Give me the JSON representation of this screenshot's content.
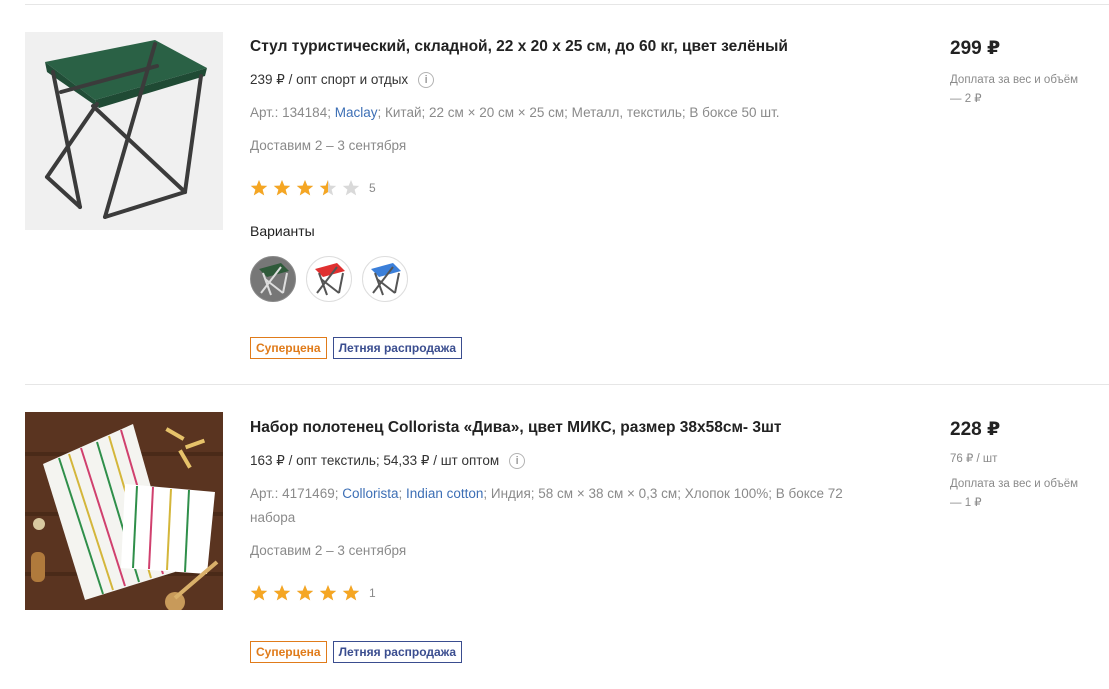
{
  "products": [
    {
      "title": "Стул туристический, складной, 22 х 20 х 25 см, до 60 кг, цвет зелёный",
      "wholesale": "239 ₽ / опт спорт и отдых",
      "specs": {
        "art": "Арт.: 134184;",
        "brand": "Maclay",
        "brand_sep": ";",
        "rest": "Китай;  22 см × 20 см × 25 см;  Металл, текстиль;  В боксе 50 шт."
      },
      "delivery": "Доставим 2 – 3 сентября",
      "rating": {
        "value": 3.5,
        "max": 5,
        "count": "5"
      },
      "variants_label": "Варианты",
      "variants": [
        {
          "color": "#2f5a3a",
          "selected": true
        },
        {
          "color": "#e03030",
          "selected": false
        },
        {
          "color": "#3b7fd9",
          "selected": false
        }
      ],
      "badges": [
        {
          "label": "Суперцена",
          "style": "orange"
        },
        {
          "label": "Летняя распродажа",
          "style": "blue"
        }
      ],
      "price": "299 ₽",
      "surcharge": "Доплата за вес и объём — 2 ₽"
    },
    {
      "title": "Набор полотенец Collorista «Дива», цвет МИКС, размер 38х58см- 3шт",
      "wholesale": "163 ₽ / опт текстиль; 54,33 ₽ / шт оптом",
      "specs": {
        "art": "Арт.: 4171469;",
        "brand": "Collorista",
        "brand_sep": ";",
        "brand2": "Indian cotton",
        "brand2_sep": ";",
        "rest": "Индия;  58 см × 38 см × 0,3 см;  Хлопок 100%;  В боксе 72 набора"
      },
      "delivery": "Доставим 2 – 3 сентября",
      "rating": {
        "value": 5,
        "max": 5,
        "count": "1"
      },
      "badges": [
        {
          "label": "Суперцена",
          "style": "orange"
        },
        {
          "label": "Летняя распродажа",
          "style": "blue"
        }
      ],
      "price": "228 ₽",
      "unit_price": "76 ₽ / шт",
      "surcharge": "Доплата за вес и объём — 1 ₽"
    }
  ],
  "colors": {
    "star": "#f5a623",
    "star_empty": "#d9d9d9",
    "link": "#3d6fb5",
    "badge_orange": "#e07b1a",
    "badge_blue": "#3a4d8f"
  }
}
